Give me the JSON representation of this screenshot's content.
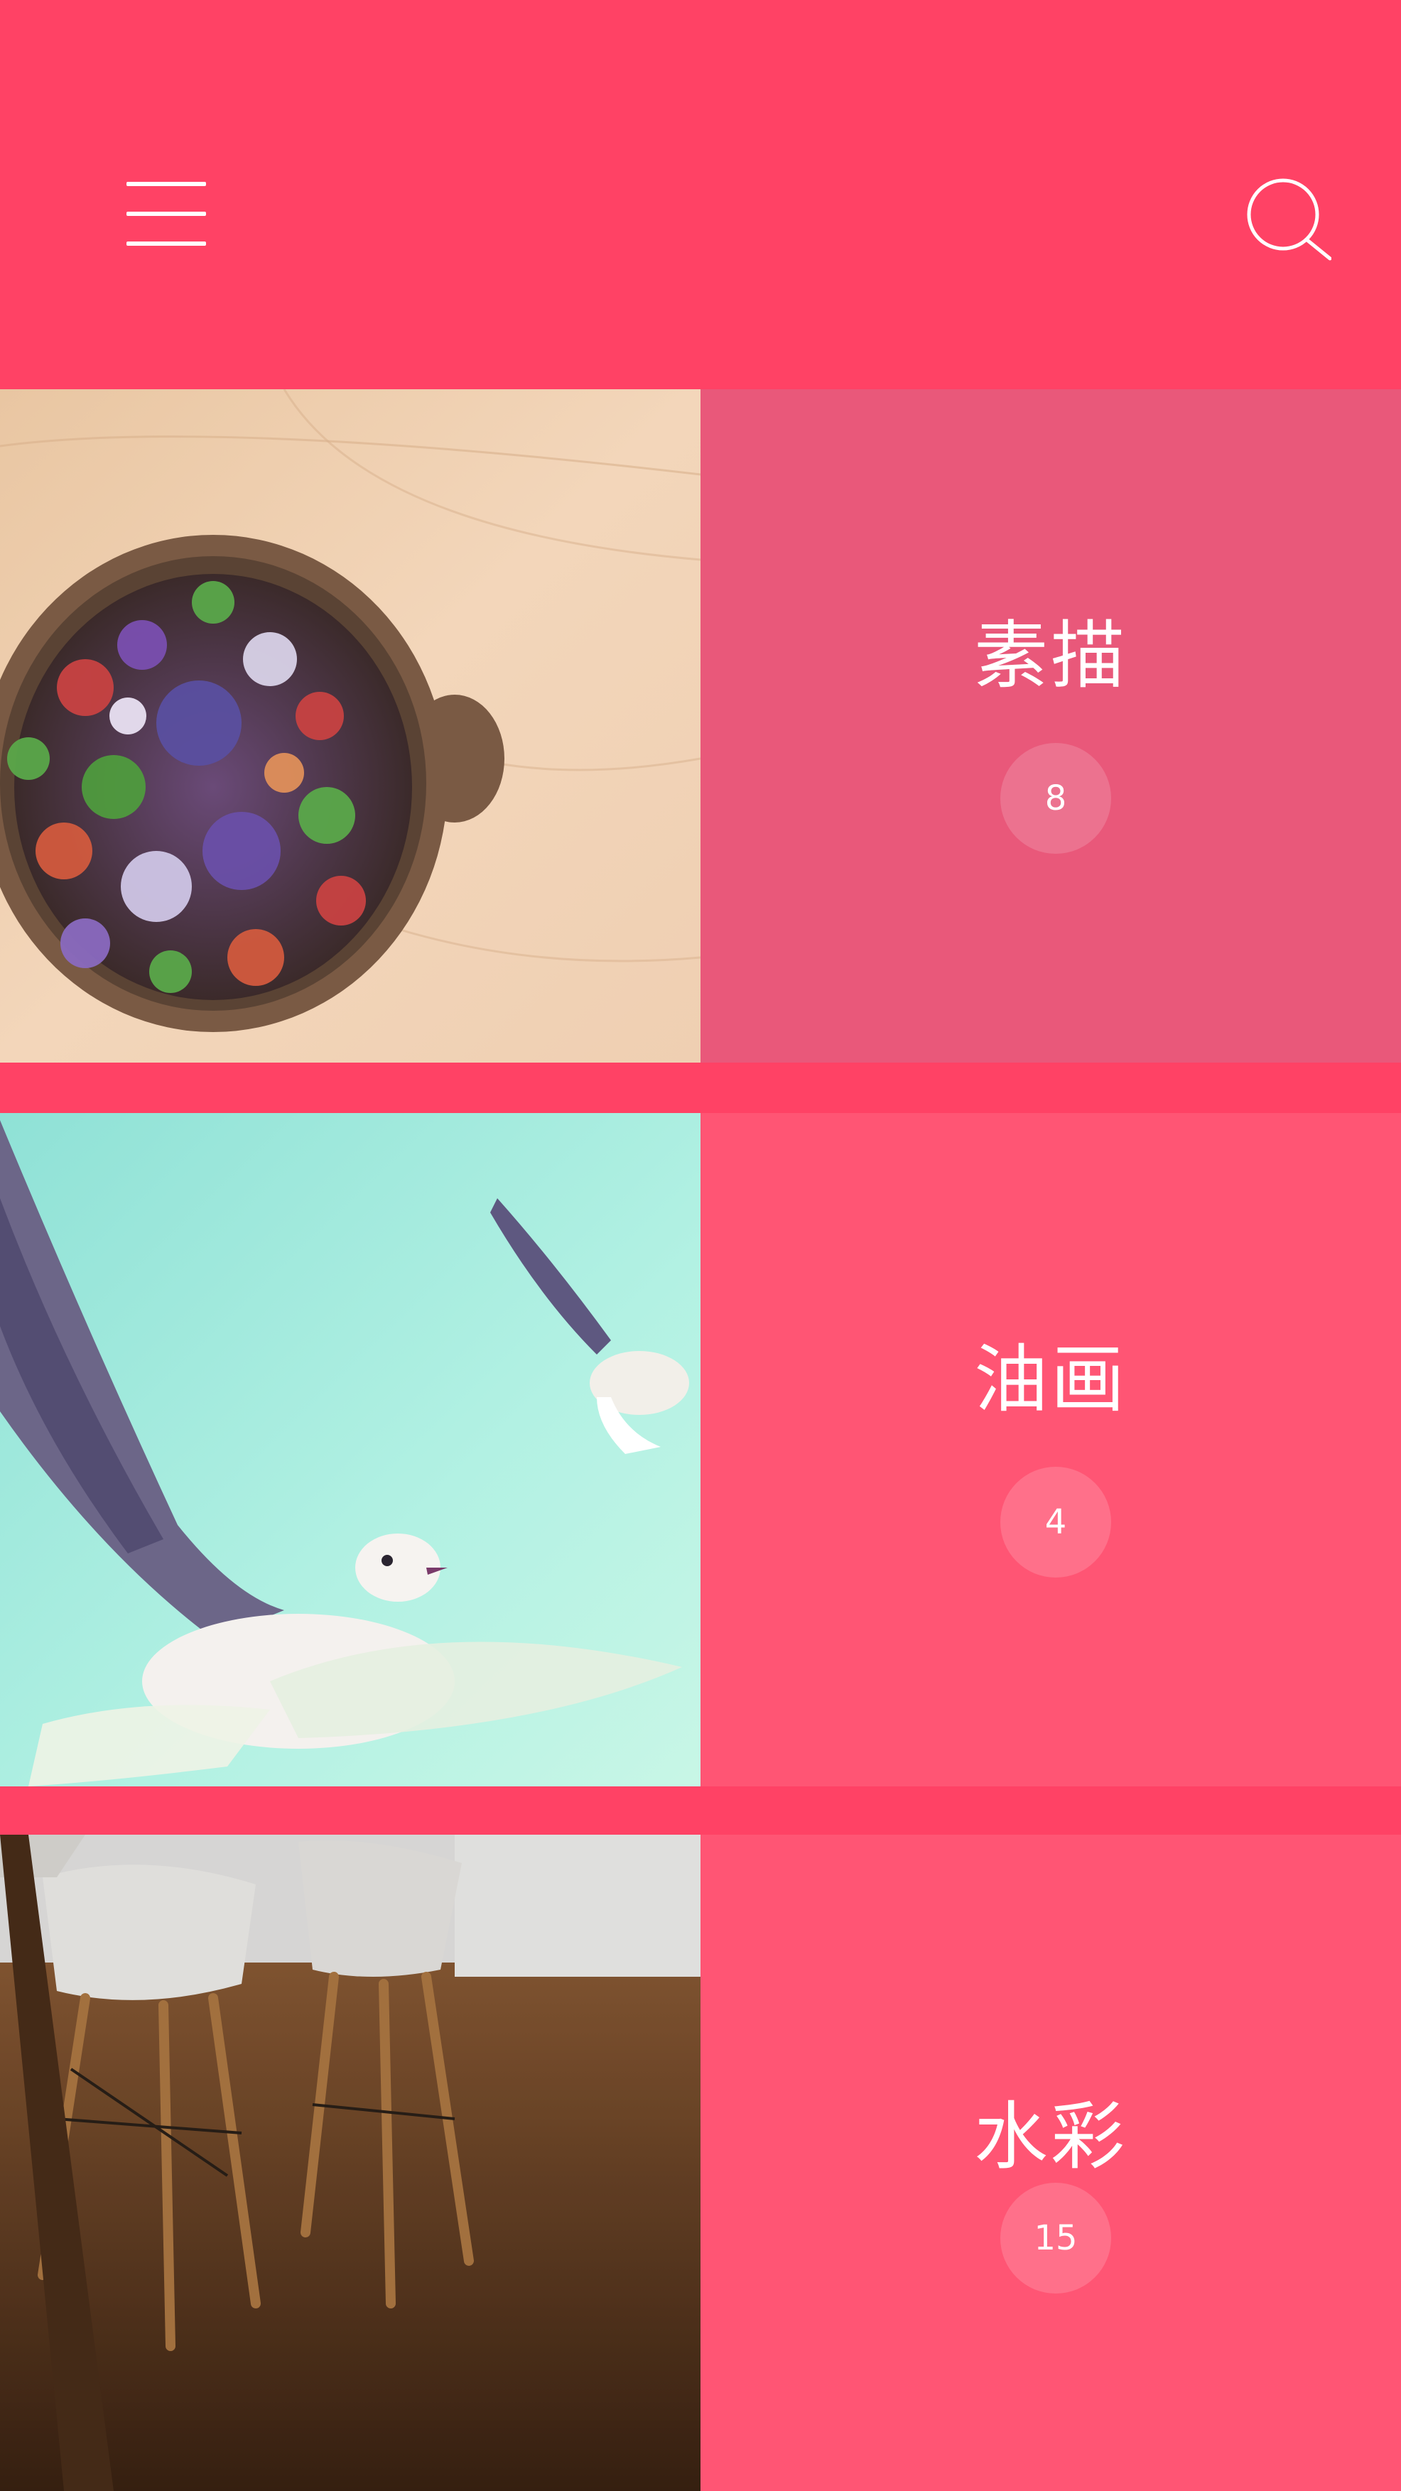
{
  "header": {
    "menu_icon": "hamburger-menu-icon",
    "search_icon": "search-icon",
    "background_color": "#ff4265"
  },
  "categories": [
    {
      "title": "素描",
      "count": "8",
      "image": "vegetable-salad-bowl-photo",
      "panel_color": "#e9587a"
    },
    {
      "title": "油画",
      "count": "4",
      "image": "flying-seagulls-photo",
      "panel_color": "#ff5574"
    },
    {
      "title": "水彩",
      "count": "15",
      "image": "white-chairs-wooden-floor-photo",
      "panel_color": "#ff5574"
    }
  ]
}
